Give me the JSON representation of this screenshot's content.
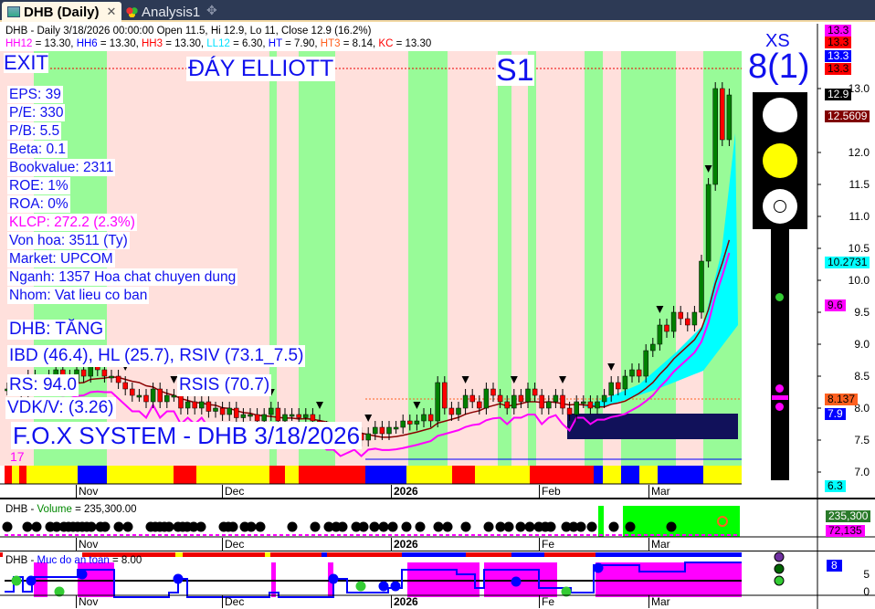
{
  "tabs": [
    {
      "label": "DHB (Daily)",
      "icon": "chart-icon",
      "close": "✕"
    },
    {
      "label": "Analysis1",
      "icon": "analysis-icon"
    }
  ],
  "add_tab_icon": "✥",
  "header": {
    "line1": "DHB - Daily 3/18/2026 00:00:00 Open 11.5, Hi 12.9, Lo 11, Close 12.9 (16.2%)",
    "line2": [
      {
        "k": "HH12",
        "v": " = 13.30, ",
        "c": "#ff00ff"
      },
      {
        "k": "HH6",
        "v": " = 13.30, ",
        "c": "#0000ff"
      },
      {
        "k": "HH3",
        "v": " = 13.30, ",
        "c": "#ff0000"
      },
      {
        "k": "LL12",
        "v": " = 6.30, ",
        "c": "#00e0ff"
      },
      {
        "k": "HT",
        "v": "  = 7.90, ",
        "c": "#0000ff"
      },
      {
        "k": "HT3",
        "v": "  = 8.14, ",
        "c": "#ff6020"
      },
      {
        "k": "KC",
        "v": " = 13.30",
        "c": "#ff0000"
      }
    ]
  },
  "overlay": {
    "exit": "EXIT",
    "elliott": "ĐÁY ELLIOTT",
    "s1": "S1",
    "fundamentals": [
      "EPS: 39",
      "P/E: 330",
      "P/B: 5.5",
      "Beta: 0.1",
      "Bookvalue: 2311",
      "ROE: 1%",
      "ROA: 0%",
      "KLCP: 272.2 (2.3%)",
      "Von hoa: 3511 (Ty)",
      "Market: UPCOM",
      "Nganh: 1357 Hoa chat chuyen dung",
      "Nhom: Vat lieu co ban"
    ],
    "trend": "DHB: TĂNG",
    "ibd": "IBD (46.4), HL (25.7), RSIV (73.1_7.5)",
    "rs": "RS: 94.0",
    "rsis": "RSIS (70.7)",
    "vdk": "VDK/V:  (3.26)",
    "system": "F.O.X SYSTEM - DHB 3/18/2026",
    "count": "17"
  },
  "signal": {
    "label": "XS",
    "value": "8(1)"
  },
  "price_axis": {
    "ticks": [
      "13.0",
      "12.0",
      "11.5",
      "11.0",
      "10.5",
      "10.0",
      "9.5",
      "9.0",
      "8.5",
      "8.0",
      "7.5",
      "7.0"
    ],
    "tags": [
      {
        "text": "13.3",
        "bg": "#ff00ff",
        "fg": "#000"
      },
      {
        "text": "13.3",
        "bg": "#ff0000",
        "fg": "#000"
      },
      {
        "text": "13.3",
        "bg": "#0000ff",
        "fg": "#fff"
      },
      {
        "text": "13.3",
        "bg": "#ff0000",
        "fg": "#000"
      },
      {
        "text": "12.9",
        "bg": "#000",
        "fg": "#fff"
      },
      {
        "text": "12.5609",
        "bg": "#800000",
        "fg": "#fff"
      },
      {
        "text": "10.2731",
        "bg": "#00ffff",
        "fg": "#000"
      },
      {
        "text": "9.6",
        "bg": "#ff00ff",
        "fg": "#000"
      },
      {
        "text": "8.137",
        "bg": "#ff6020",
        "fg": "#000"
      },
      {
        "text": "7.9",
        "bg": "#0000ff",
        "fg": "#fff"
      },
      {
        "text": "6.3",
        "bg": "#00ffff",
        "fg": "#000"
      }
    ]
  },
  "months": [
    "Nov",
    "Dec",
    "2026",
    "Feb",
    "Mar"
  ],
  "volume_panel": {
    "title_sym": "DHB",
    "title_name": "Volume",
    "title_val": " = 235,300.00",
    "tag1": "235,300",
    "tag2": "72,135",
    "months": [
      "Nov",
      "Dec",
      "2026",
      "Fe",
      "Mar"
    ]
  },
  "safety_panel": {
    "title_sym": "DHB",
    "title_name": "Muc do an toan",
    "title_val": " = 8.00",
    "tag": "8",
    "ticks": [
      "5",
      "0"
    ],
    "months": [
      "Nov",
      "Dec",
      "2026",
      "Fe",
      "Mar"
    ]
  },
  "chart_data": {
    "type": "candlestick",
    "symbol": "DHB",
    "interval": "Daily",
    "ylim": [
      6.5,
      13.5
    ],
    "closes": [
      8.3,
      8.4,
      8.2,
      8.5,
      8.4,
      8.3,
      8.5,
      8.6,
      8.5,
      8.4,
      8.6,
      8.5,
      8.7,
      8.6,
      8.5,
      8.5,
      8.4,
      8.3,
      8.2,
      8.2,
      8.1,
      8.3,
      8.1,
      8.2,
      8.2,
      8.0,
      8.1,
      8.0,
      8.1,
      7.95,
      8.0,
      7.9,
      8.0,
      7.85,
      7.9,
      7.9,
      7.8,
      7.9,
      8.0,
      7.8,
      7.9,
      7.9,
      7.85,
      7.9,
      7.8,
      7.7,
      7.6,
      7.6,
      7.5,
      7.55,
      7.6,
      7.5,
      7.6,
      7.7,
      7.6,
      7.7,
      7.7,
      7.8,
      7.75,
      7.8,
      7.9,
      7.8,
      8.4,
      8.0,
      7.9,
      8.0,
      8.2,
      8.1,
      8.0,
      8.3,
      8.2,
      8.1,
      8.0,
      8.2,
      8.1,
      8.3,
      8.2,
      8.0,
      8.1,
      8.2,
      8.0,
      7.9,
      8.1,
      8.1,
      8.0,
      8.1,
      8.2,
      8.4,
      8.3,
      8.5,
      8.6,
      8.5,
      8.9,
      9.0,
      9.3,
      9.2,
      9.5,
      9.4,
      9.3,
      9.5,
      10.3,
      11.5,
      13.0,
      12.2,
      12.9
    ]
  },
  "colors": {
    "up": "#008000",
    "down": "#ff0000",
    "green_band": "#98fb98",
    "pink_band": "#ffe0dc",
    "accent": "#1010ee"
  }
}
